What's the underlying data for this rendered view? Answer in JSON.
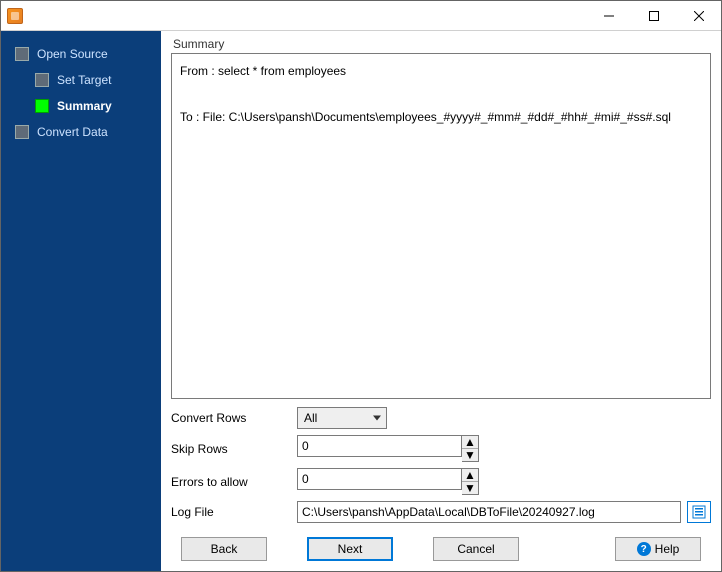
{
  "window": {
    "title": ""
  },
  "sidebar": {
    "items": [
      {
        "label": "Open Source",
        "active": false
      },
      {
        "label": "Set Target",
        "active": false
      },
      {
        "label": "Summary",
        "active": true
      },
      {
        "label": "Convert Data",
        "active": false
      }
    ]
  },
  "main": {
    "section_title": "Summary",
    "summary_text": "From : select * from employees\n\nTo : File: C:\\Users\\pansh\\Documents\\employees_#yyyy#_#mm#_#dd#_#hh#_#mi#_#ss#.sql"
  },
  "options": {
    "convert_rows": {
      "label": "Convert Rows",
      "value": "All"
    },
    "skip_rows": {
      "label": "Skip Rows",
      "value": "0"
    },
    "errors_to_allow": {
      "label": "Errors to allow",
      "value": "0"
    },
    "log_file": {
      "label": "Log File",
      "value": "C:\\Users\\pansh\\AppData\\Local\\DBToFile\\20240927.log"
    }
  },
  "footer": {
    "back": "Back",
    "next": "Next",
    "cancel": "Cancel",
    "help": "Help"
  }
}
